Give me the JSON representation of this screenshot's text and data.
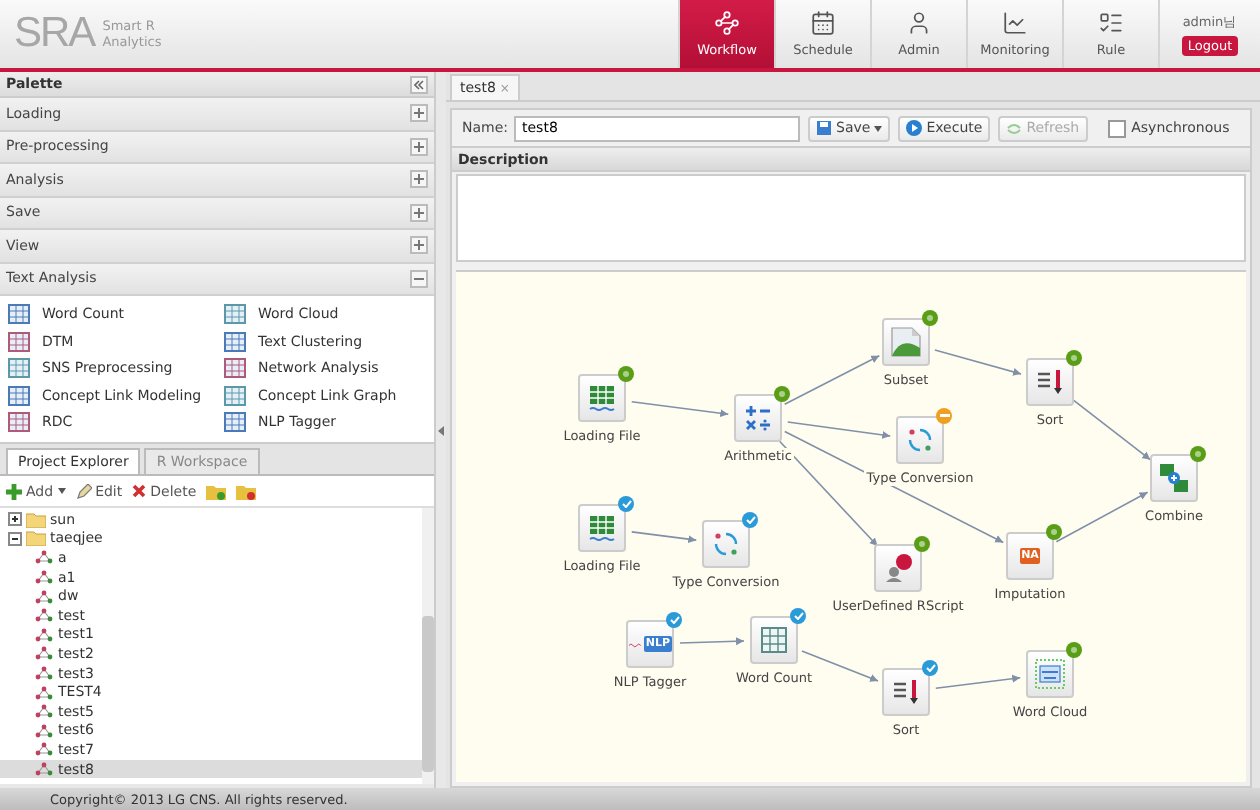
{
  "brand": {
    "logo": "SRA",
    "tagline": "Smart R Analytics"
  },
  "nav": [
    {
      "label": "Workflow",
      "kind": "workflow",
      "selected": true
    },
    {
      "label": "Schedule",
      "kind": "schedule",
      "selected": false
    },
    {
      "label": "Admin",
      "kind": "admin",
      "selected": false
    },
    {
      "label": "Monitoring",
      "kind": "monitoring",
      "selected": false
    },
    {
      "label": "Rule",
      "kind": "rule",
      "selected": false
    }
  ],
  "user": {
    "name": "admin님",
    "logout": "Logout"
  },
  "palette": {
    "title": "Palette",
    "sections": [
      {
        "label": "Loading",
        "expanded": false
      },
      {
        "label": "Pre-processing",
        "expanded": false
      },
      {
        "label": "Analysis",
        "expanded": false
      },
      {
        "label": "Save",
        "expanded": false
      },
      {
        "label": "View",
        "expanded": false
      },
      {
        "label": "Text Analysis",
        "expanded": true
      }
    ],
    "items": [
      "Word Count",
      "Word Cloud",
      "DTM",
      "Text Clustering",
      "SNS Preprocessing",
      "Network Analysis",
      "Concept Link Modeling",
      "Concept Link Graph",
      "RDC",
      "NLP Tagger"
    ]
  },
  "explorer": {
    "tabs": [
      {
        "label": "Project Explorer",
        "selected": true
      },
      {
        "label": "R Workspace",
        "selected": false
      }
    ],
    "toolbar": {
      "add": "Add",
      "edit": "Edit",
      "delete": "Delete"
    },
    "tree": [
      {
        "label": "sun",
        "expanded": false
      },
      {
        "label": "taeqjee",
        "expanded": true,
        "children": [
          {
            "label": "a",
            "selected": false
          },
          {
            "label": "a1",
            "selected": false
          },
          {
            "label": "dw",
            "selected": false
          },
          {
            "label": "test",
            "selected": false
          },
          {
            "label": "test1",
            "selected": false
          },
          {
            "label": "test2",
            "selected": false
          },
          {
            "label": "test3",
            "selected": false
          },
          {
            "label": "TEST4",
            "selected": false
          },
          {
            "label": "test5",
            "selected": false
          },
          {
            "label": "test6",
            "selected": false
          },
          {
            "label": "test7",
            "selected": false
          },
          {
            "label": "test8",
            "selected": true
          }
        ]
      }
    ]
  },
  "editor": {
    "tab": {
      "label": "test8",
      "close": "×"
    },
    "name_label": "Name:",
    "name_value": "test8",
    "save": "Save",
    "execute": "Execute",
    "refresh": {
      "label": "Refresh",
      "disabled": true
    },
    "asynchronous": {
      "label": "Asynchronous",
      "checked": false
    },
    "description": "Description"
  },
  "nodes": [
    {
      "label": "Loading File",
      "kind": "table",
      "badge": {
        "kind": "dot",
        "color": "#5a9e18"
      }
    },
    {
      "label": "Arithmetic",
      "kind": "arithmetic",
      "badge": {
        "kind": "dot",
        "color": "#5a9e18"
      }
    },
    {
      "label": "Subset",
      "kind": "image",
      "badge": {
        "kind": "dot",
        "color": "#5a9e18"
      }
    },
    {
      "label": "Type Conversion",
      "kind": "convert",
      "badge": {
        "kind": "minus",
        "color": "#f0a020"
      }
    },
    {
      "label": "Sort",
      "kind": "sort",
      "badge": {
        "kind": "dot",
        "color": "#5a9e18"
      }
    },
    {
      "label": "Combine",
      "kind": "combine",
      "badge": {
        "kind": "dot",
        "color": "#5a9e18"
      }
    },
    {
      "label": "Loading File",
      "kind": "table",
      "badge": {
        "kind": "check",
        "color": "#2a9ad8"
      }
    },
    {
      "label": "Type Conversion",
      "kind": "convert",
      "badge": {
        "kind": "check",
        "color": "#2a9ad8"
      }
    },
    {
      "label": "UserDefined RScript",
      "kind": "rscript",
      "badge": {
        "kind": "dot",
        "color": "#5a9e18"
      }
    },
    {
      "label": "Imputation",
      "kind": "imputation",
      "badge": {
        "kind": "dot",
        "color": "#5a9e18"
      },
      "icon_text": "NA"
    },
    {
      "label": "NLP Tagger",
      "kind": "nlp",
      "badge": {
        "kind": "check",
        "color": "#2a9ad8"
      },
      "icon_text": "NLP"
    },
    {
      "label": "Word Count",
      "kind": "wordcount",
      "badge": {
        "kind": "check",
        "color": "#2a9ad8"
      }
    },
    {
      "label": "Sort",
      "kind": "sort",
      "badge": {
        "kind": "check",
        "color": "#2a9ad8"
      }
    },
    {
      "label": "Word Cloud",
      "kind": "wordcloud",
      "badge": {
        "kind": "dot",
        "color": "#5a9e18"
      }
    }
  ],
  "footer": "Copyright© 2013 LG CNS. All rights reserved."
}
